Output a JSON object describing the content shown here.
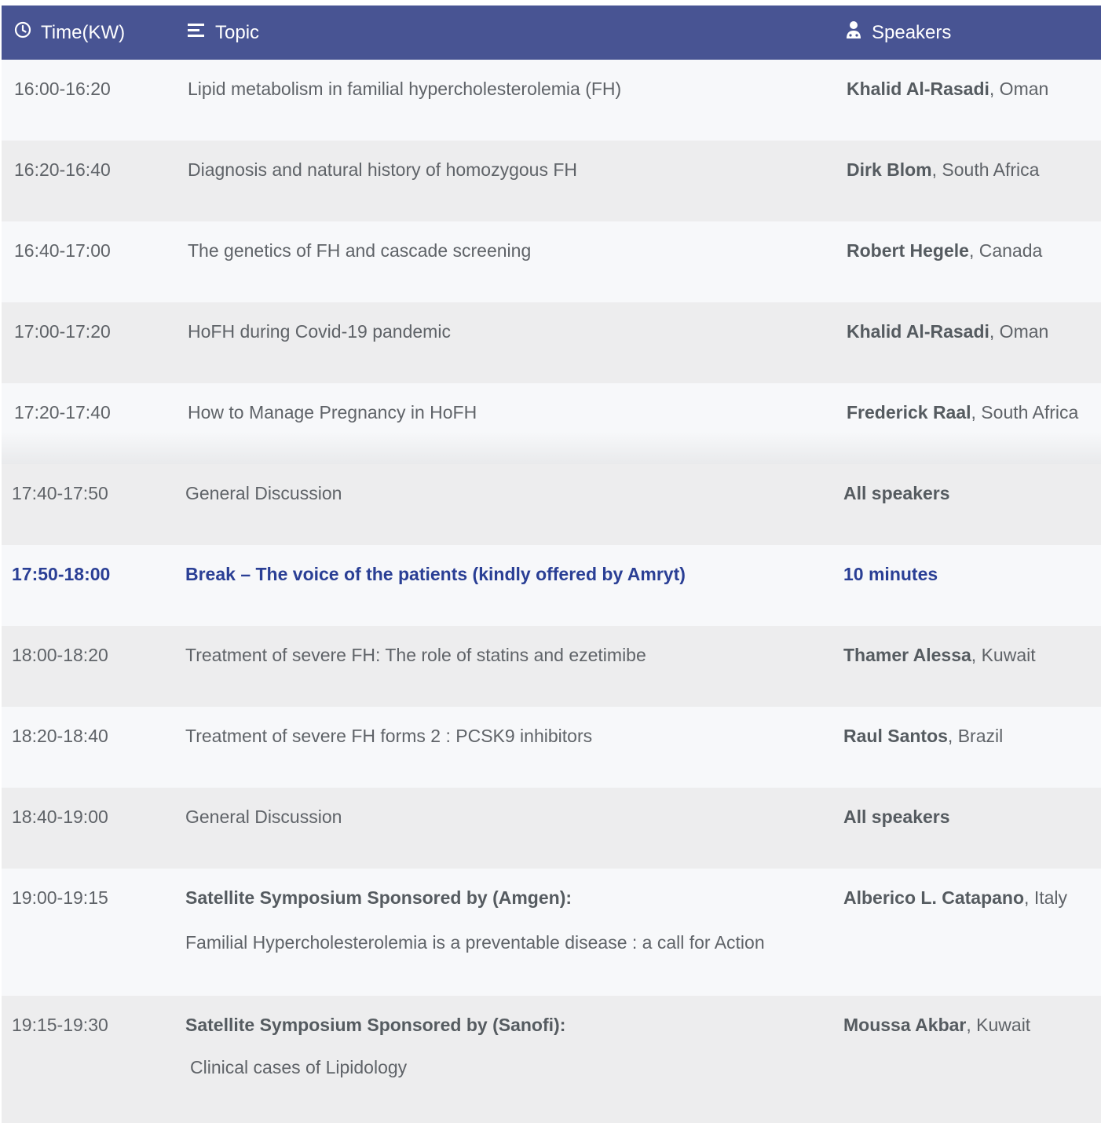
{
  "header": {
    "time_label": "Time(KW)",
    "topic_label": "Topic",
    "speakers_label": "Speakers",
    "icons": [
      "clock-icon",
      "list-icon",
      "speaker-icon"
    ]
  },
  "colors": {
    "header_bg": "#485493",
    "break_text": "#2a3f95",
    "row_light": "#f7f8fa",
    "row_dark": "#ededee"
  },
  "rows": [
    {
      "time": "16:00-16:20",
      "topic": "Lipid metabolism in familial hypercholesterolemia (FH)",
      "speaker": "Khalid Al-Rasadi",
      "country": ", Oman"
    },
    {
      "time": "16:20-16:40",
      "topic": "Diagnosis and natural history of homozygous FH",
      "speaker": "Dirk Blom",
      "country": ", South Africa"
    },
    {
      "time": "16:40-17:00",
      "topic": "The genetics of FH and cascade screening",
      "speaker": "Robert Hegele",
      "country": ", Canada"
    },
    {
      "time": "17:00-17:20",
      "topic": "HoFH during Covid-19 pandemic",
      "speaker": "Khalid Al-Rasadi",
      "country": ", Oman"
    },
    {
      "time": "17:20-17:40",
      "topic": "How to Manage Pregnancy in HoFH",
      "speaker": "Frederick Raal",
      "country": ", South Africa"
    },
    {
      "time": "17:40-17:50",
      "topic": "General Discussion",
      "speaker": "All speakers",
      "country": ""
    },
    {
      "time": "17:50-18:00",
      "topic": "Break – The voice of the patients (kindly offered by Amryt)",
      "speaker": "10 minutes",
      "country": ""
    },
    {
      "time": "18:00-18:20",
      "topic": "Treatment of severe FH: The role of statins and ezetimibe",
      "speaker": "Thamer Alessa",
      "country": ", Kuwait"
    },
    {
      "time": "18:20-18:40",
      "topic": "Treatment of severe FH forms 2 : PCSK9 inhibitors",
      "speaker": "Raul Santos",
      "country": ", Brazil"
    },
    {
      "time": "18:40-19:00",
      "topic": "General Discussion",
      "speaker": "All speakers",
      "country": ""
    },
    {
      "time": "19:00-19:15",
      "topic": "Satellite Symposium Sponsored by (Amgen):",
      "subtopic": "Familial Hypercholesterolemia is a preventable disease : a call for Action",
      "speaker": "Alberico L. Catapano",
      "country": ", Italy"
    },
    {
      "time": "19:15-19:30",
      "topic": "Satellite Symposium Sponsored by (Sanofi):",
      "subtopic": "Clinical cases of Lipidology",
      "speaker": "Moussa Akbar",
      "country": ", Kuwait"
    }
  ]
}
